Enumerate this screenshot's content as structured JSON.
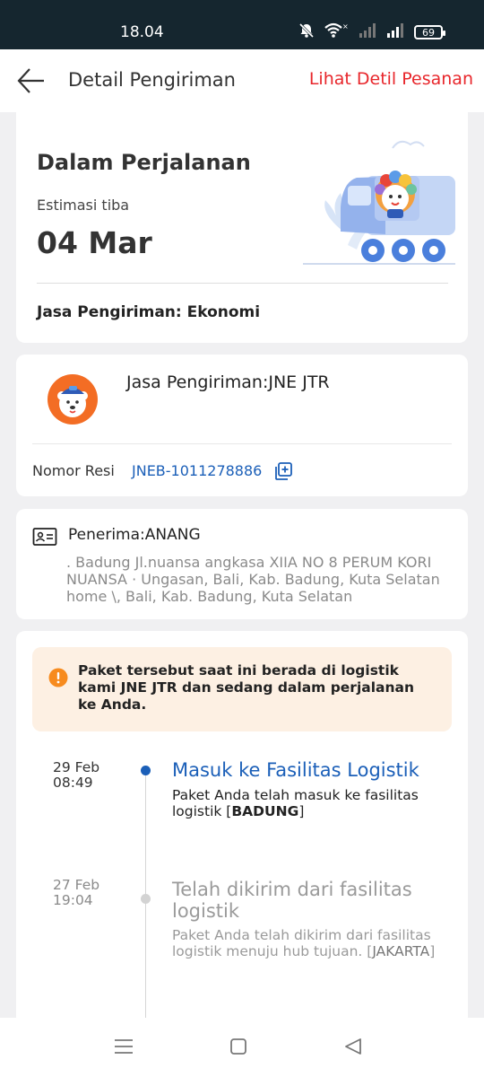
{
  "status_bar": {
    "time": "18.04",
    "battery": "69",
    "icons": [
      "mute-icon",
      "wifi-icon",
      "signal-icon",
      "signal-icon",
      "battery-icon"
    ]
  },
  "header": {
    "title": "Detail Pengiriman",
    "order_link": "Lihat Detil Pesanan",
    "link_color": "#e8262b"
  },
  "shipment": {
    "status": "Dalam Perjalanan",
    "eta_label": "Estimasi tiba",
    "eta_date": "04 Mar",
    "service": "Jasa Pengiriman: Ekonomi"
  },
  "courier": {
    "name": "Jasa Pengiriman:JNE JTR",
    "resi_label": "Nomor Resi",
    "resi_number": "JNEB-1011278886",
    "link_color": "#1b5fb8"
  },
  "recipient": {
    "name": "Penerima:ANANG",
    "address": ". Badung Jl.nuansa angkasa XIIA NO 8 PERUM KORI NUANSA · Ungasan, Bali, Kab. Badung, Kuta Selatan home \\, Bali, Kab. Badung, Kuta Selatan"
  },
  "tracking": {
    "notice": "Paket tersebut saat ini berada di logistik kami JNE JTR dan sedang dalam perjalanan ke Anda.",
    "events": [
      {
        "date": "29 Feb",
        "time": "08:49",
        "title": "Masuk ke Fasilitas Logistik",
        "desc_prefix": "Paket Anda telah masuk ke fasilitas logistik [",
        "desc_location": "BADUNG",
        "desc_suffix": "]",
        "active": true
      },
      {
        "date": "27 Feb",
        "time": "19:04",
        "title": "Telah dikirim dari fasilitas logistik",
        "desc_prefix": "Paket Anda telah dikirim dari fasilitas logistik menuju hub tujuan. [",
        "desc_location": "JAKARTA",
        "desc_suffix": "]",
        "active": false
      }
    ]
  },
  "nav": [
    "menu-icon",
    "home-icon",
    "back-icon"
  ]
}
